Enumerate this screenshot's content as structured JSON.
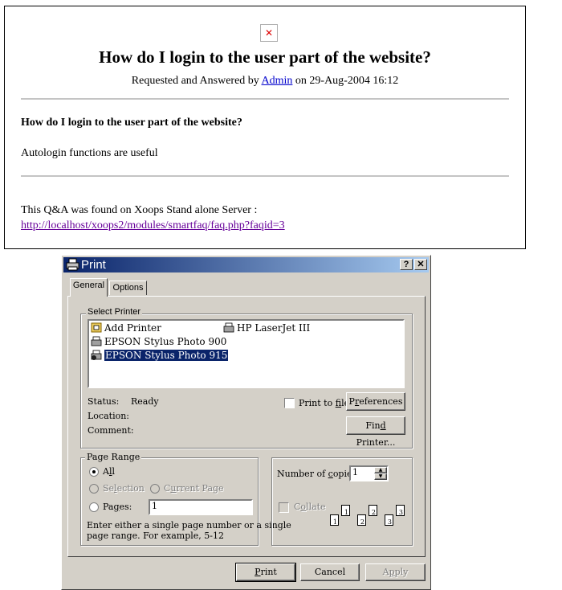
{
  "faq": {
    "title": "How do I login to the user part of the website?",
    "byline_prefix": "Requested and Answered by ",
    "author": "Admin",
    "byline_suffix": " on 29-Aug-2004 16:12",
    "question": "How do I login to the user part of the website?",
    "answer": "Autologin functions are useful",
    "found_text": "This Q&A was found on Xoops Stand alone Server :",
    "url": "http://localhost/xoops2/modules/smartfaq/faq.php?faqid=3"
  },
  "dialog": {
    "title": "Print",
    "help_button": "?",
    "close_button": "✕",
    "tabs": [
      "General",
      "Options"
    ],
    "select_printer_label": "Select Printer",
    "printers": [
      "Add Printer",
      "HP LaserJet III",
      "EPSON Stylus Photo 900",
      "EPSON Stylus Photo 915"
    ],
    "selected_printer": "EPSON Stylus Photo 915",
    "status_label": "Status:",
    "status_value": "Ready",
    "location_label": "Location:",
    "comment_label": "Comment:",
    "print_to_file_pre": "Print to ",
    "print_to_file_u": "f",
    "print_to_file_post": "ile",
    "preferences_pre": "P",
    "preferences_u": "r",
    "preferences_post": "eferences",
    "find_printer_pre": "Fin",
    "find_printer_u": "d",
    "find_printer_post": " Printer...",
    "page_range_label": "Page Range",
    "all_pre": "A",
    "all_u": "l",
    "all_post": "l",
    "selection_pre": "Se",
    "selection_u": "l",
    "selection_post": "ection",
    "current_page_pre": "C",
    "current_page_u": "u",
    "current_page_post": "rrent Page",
    "pages_pre": "Pa",
    "pages_u": "g",
    "pages_post": "es:",
    "pages_value": "1",
    "hint_line1": "Enter either a single page number or a single",
    "hint_line2": "page range.  For example, 5-12",
    "copies_pre": "Number of ",
    "copies_u": "c",
    "copies_post": "opies:",
    "copies_value": "1",
    "collate_pre": "C",
    "collate_u": "o",
    "collate_post": "llate",
    "collate_pages": [
      "1",
      "1",
      "2",
      "2",
      "3",
      "3"
    ],
    "print_u": "P",
    "print_post": "rint",
    "cancel_label": "Cancel",
    "apply_pre": "A",
    "apply_u": "p",
    "apply_post": "ply"
  },
  "colors": {
    "titlebar": "#0a246a",
    "face": "#d4d0c8",
    "link": "#0000cc",
    "visited": "#660099"
  }
}
